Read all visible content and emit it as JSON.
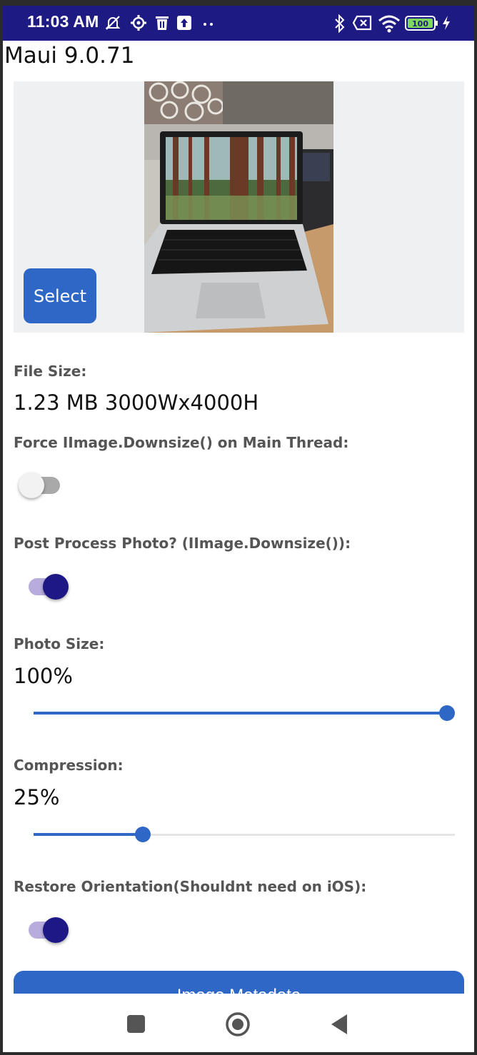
{
  "status_bar": {
    "time": "11:03 AM",
    "icons_left": [
      "notifications-muted-icon",
      "settings-icon",
      "trash-icon",
      "upload-icon",
      "more-dots-icon"
    ],
    "icons_right": [
      "bluetooth-icon",
      "sim-x-icon",
      "wifi-icon",
      "battery-icon",
      "charging-icon"
    ],
    "battery_level": "100"
  },
  "app": {
    "title": "Maui 9.0.71"
  },
  "image_picker": {
    "select_label": "Select"
  },
  "file_size": {
    "label": "File Size:",
    "value": "1.23 MB 3000Wx4000H"
  },
  "force_main_thread": {
    "label": "Force IImage.Downsize() on Main Thread:",
    "checked": false
  },
  "post_process": {
    "label": "Post Process Photo? (IImage.Downsize()):",
    "checked": true
  },
  "photo_size": {
    "label": "Photo Size:",
    "value_text": "100%",
    "value": 100
  },
  "compression": {
    "label": "Compression:",
    "value_text": "25%",
    "value": 25
  },
  "restore_orientation": {
    "label": "Restore Orientation(Shouldnt need on iOS):",
    "checked": true
  },
  "metadata_button": {
    "label": "Image Metadata"
  },
  "nav": {
    "items": [
      "recents-square-icon",
      "home-circle-icon",
      "back-triangle-icon"
    ]
  },
  "colors": {
    "status_bar": "#1d1a84",
    "accent": "#2e67c6",
    "switch_on_thumb": "#1e1887",
    "switch_on_track": "#b7acdc"
  }
}
